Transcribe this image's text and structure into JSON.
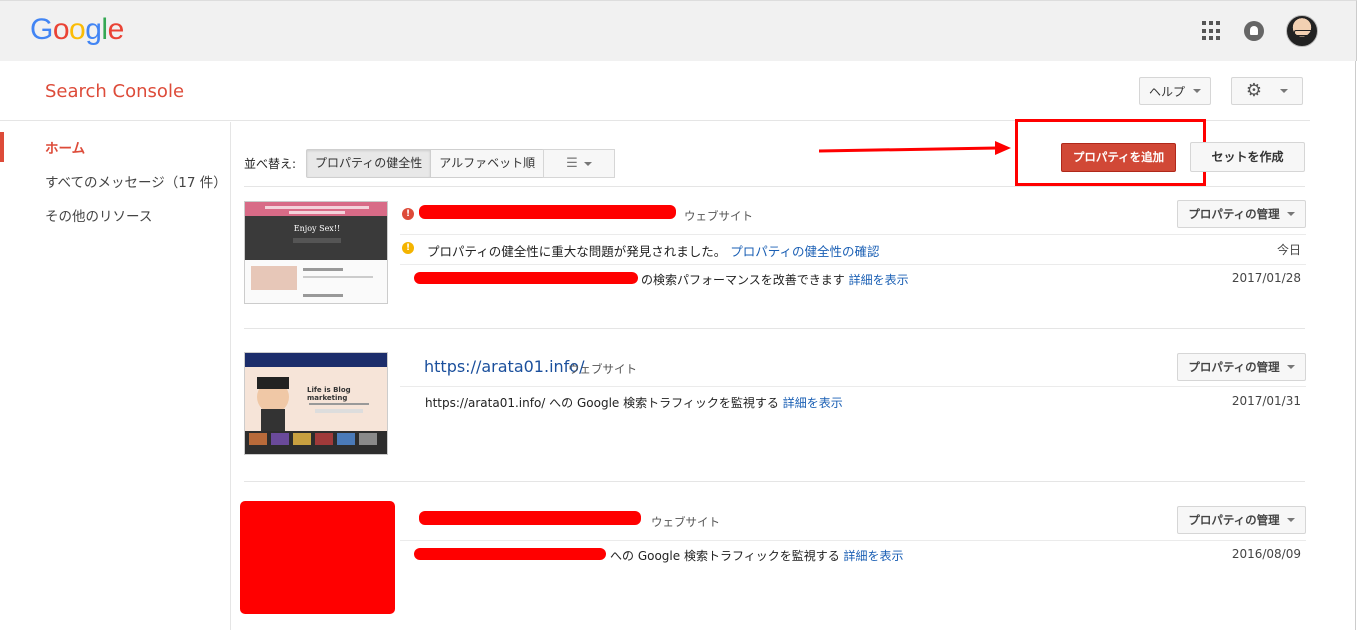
{
  "header": {
    "logo_letters": [
      {
        "ch": "G",
        "color": "#4285F4"
      },
      {
        "ch": "o",
        "color": "#EA4335"
      },
      {
        "ch": "o",
        "color": "#FBBC05"
      },
      {
        "ch": "g",
        "color": "#4285F4"
      },
      {
        "ch": "l",
        "color": "#34A853"
      },
      {
        "ch": "e",
        "color": "#EA4335"
      }
    ],
    "icons": [
      "apps-icon",
      "notifications-icon",
      "avatar"
    ]
  },
  "appbar": {
    "product_name": "Search Console",
    "help_label": "ヘルプ",
    "settings_icon": "gear-icon"
  },
  "sidebar": {
    "items": [
      {
        "label": "ホーム",
        "active": true
      },
      {
        "label": "すべてのメッセージ（17 件）",
        "active": false
      },
      {
        "label": "その他のリソース",
        "active": false
      }
    ]
  },
  "toolbar": {
    "sort_label": "並べ替え:",
    "sort_options": [
      "プロパティの健全性",
      "アルファベット順"
    ],
    "sort_selected": "プロパティの健全性",
    "add_property_label": "プロパティを追加",
    "create_set_label": "セットを作成"
  },
  "properties": [
    {
      "url": "",
      "kind": "ウェブサイト",
      "manage_label": "プロパティの管理",
      "messages": [
        {
          "text": "プロパティの健全性に重大な問題が発見されました。",
          "link": "プロパティの健全性の確認",
          "date": "今日",
          "icon": "warning-icon"
        },
        {
          "text": "の検索パフォーマンスを改善できます",
          "link": "詳細を表示",
          "date": "2017/01/28"
        }
      ],
      "thumb_caption": "Enjoy Sex!!"
    },
    {
      "url": "https://arata01.info/",
      "kind": "ウェブサイト",
      "manage_label": "プロパティの管理",
      "messages": [
        {
          "text": "https://arata01.info/ への Google 検索トラフィックを監視する",
          "link": "詳細を表示",
          "date": "2017/01/31"
        }
      ],
      "thumb_caption": "Life is Blog marketing"
    },
    {
      "url": "",
      "kind": "ウェブサイト",
      "manage_label": "プロパティの管理",
      "messages": [
        {
          "text": "への Google 検索トラフィックを監視する",
          "link": "詳細を表示",
          "date": "2016/08/09"
        }
      ]
    }
  ],
  "colors": {
    "accent": "#dd4b39",
    "add_button": "#d14836",
    "annotation": "#ff0000",
    "link": "#1a5fb4"
  }
}
